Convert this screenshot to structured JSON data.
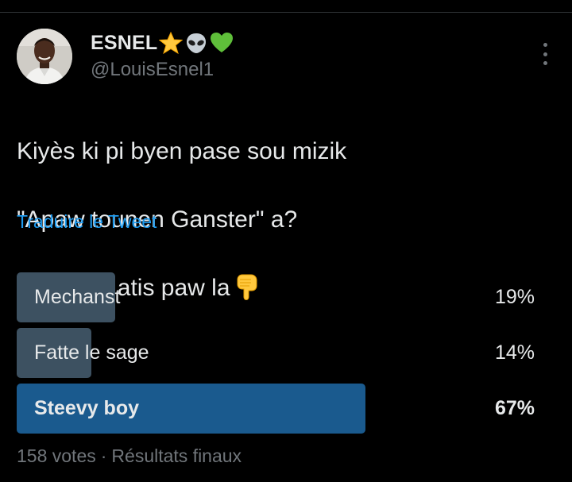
{
  "author": {
    "display_name": "ESNEL",
    "name_emojis": [
      "star-emoji",
      "alien-emoji",
      "green-heart-emoji"
    ],
    "handle": "@LouisEsnel1"
  },
  "tweet": {
    "lines": [
      "Kiyès ki pi byen pase sou mizik",
      "\"Apaw tounen Ganster\" a?",
      "Vote pou atis paw la"
    ],
    "trailing_emoji": "hand-pointing-down-emoji",
    "translate_label": "Traduire le Tweet"
  },
  "poll": {
    "options": [
      {
        "label": "Mechanst",
        "percent_label": "19%",
        "percent": 19,
        "winner": false
      },
      {
        "label": "Fatte le sage",
        "percent_label": "14%",
        "percent": 14,
        "winner": false
      },
      {
        "label": "Steevy boy",
        "percent_label": "67%",
        "percent": 67,
        "winner": true
      }
    ],
    "votes": "158 votes",
    "separator": "·",
    "status": "Résultats finaux"
  },
  "colors": {
    "background": "#000000",
    "text": "#e7e9ea",
    "muted": "#71767b",
    "link": "#1d9bf0",
    "bar": "#3d5161",
    "bar_winner": "#1a5a8e"
  }
}
